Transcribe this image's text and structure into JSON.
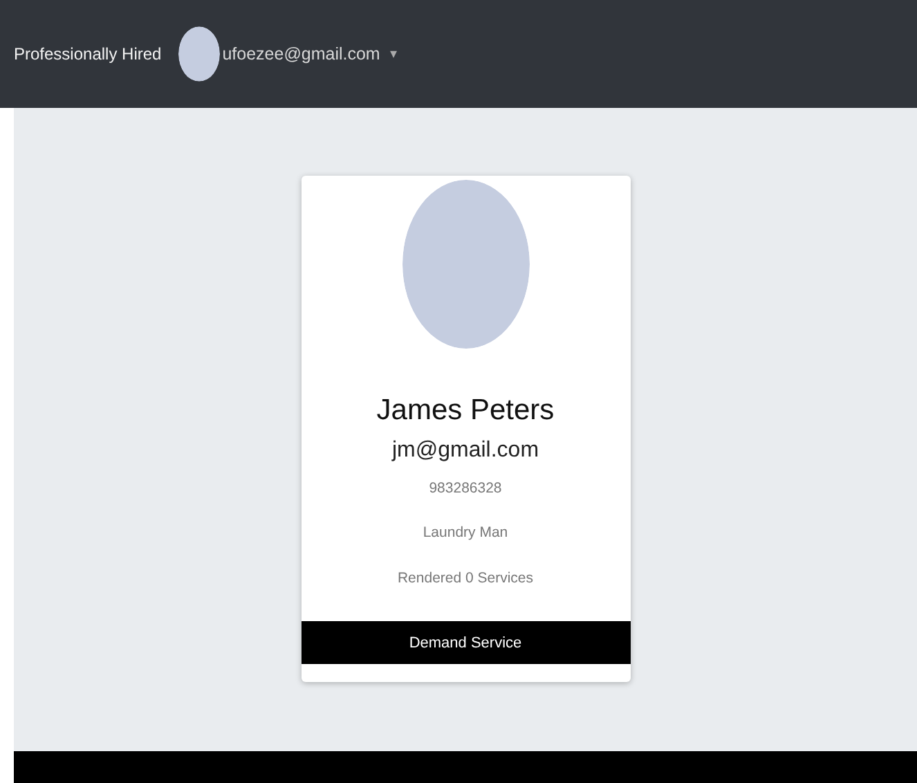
{
  "navbar": {
    "brand": "Professionally Hired",
    "user_email": "ufoezee@gmail.com",
    "caret": "▾"
  },
  "profile": {
    "name": "James Peters",
    "email": "jm@gmail.com",
    "phone": "983286328",
    "occupation": "Laundry Man",
    "services": "Rendered 0 Services",
    "action": "Demand Service"
  }
}
